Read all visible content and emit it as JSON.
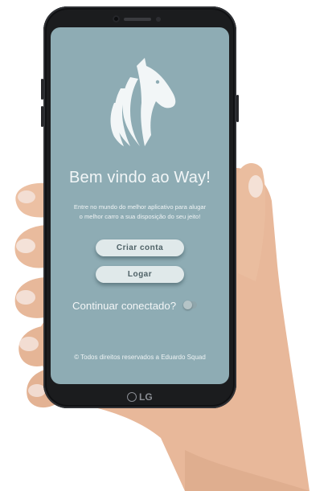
{
  "device": {
    "brand": "LG",
    "frame_color": "#1b1c1e"
  },
  "screen": {
    "background_color": "#8eacb4",
    "logo_icon": "horse-head-icon",
    "welcome_title": "Bem vindo ao Way!",
    "tagline": "Entre no mundo do melhor aplicativo para alugar o melhor carro a sua disposição do seu jeito!",
    "buttons": {
      "create_account": "Criar conta",
      "login": "Logar"
    },
    "stay_connected": {
      "label": "Continuar conectado?",
      "enabled": false
    },
    "copyright": "© Todos direitos reservados a Eduardo Squad"
  }
}
